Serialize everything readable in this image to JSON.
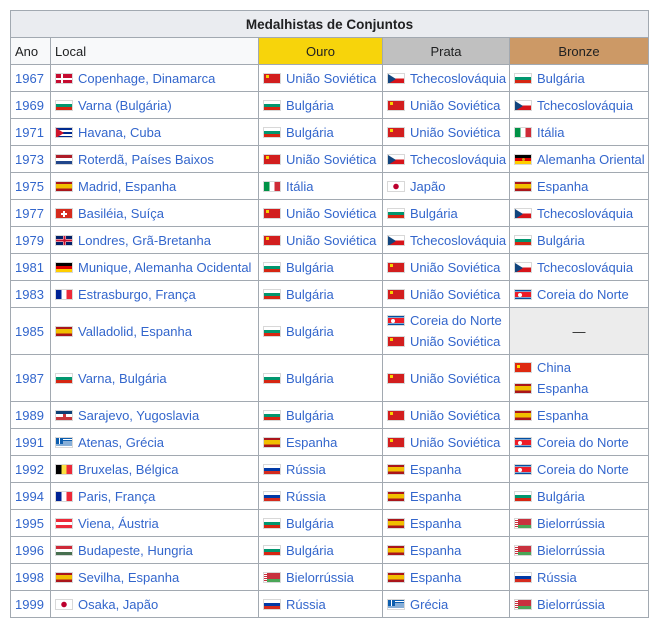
{
  "table": {
    "title": "Medalhistas de Conjuntos",
    "headers": {
      "year": "Ano",
      "local": "Local",
      "gold": "Ouro",
      "silver": "Prata",
      "bronze": "Bronze"
    },
    "colors": {
      "gold": "#f7d40b",
      "silver": "#c0c0c0",
      "bronze": "#cc9966",
      "link": "#3366cc"
    },
    "rows": [
      {
        "year": "1967",
        "local": {
          "flag": "DK",
          "text": "Copenhage, Dinamarca"
        },
        "gold": [
          {
            "flag": "SU",
            "text": "União Soviética"
          }
        ],
        "silver": [
          {
            "flag": "CS",
            "text": "Tchecoslováquia"
          }
        ],
        "bronze": [
          {
            "flag": "BG",
            "text": "Bulgária"
          }
        ]
      },
      {
        "year": "1969",
        "local": {
          "flag": "BG",
          "text": "Varna (Bulgária)"
        },
        "gold": [
          {
            "flag": "BG",
            "text": "Bulgária"
          }
        ],
        "silver": [
          {
            "flag": "SU",
            "text": "União Soviética"
          }
        ],
        "bronze": [
          {
            "flag": "CS",
            "text": "Tchecoslováquia"
          }
        ]
      },
      {
        "year": "1971",
        "local": {
          "flag": "CU",
          "text": "Havana, Cuba"
        },
        "gold": [
          {
            "flag": "BG",
            "text": "Bulgária"
          }
        ],
        "silver": [
          {
            "flag": "SU",
            "text": "União Soviética"
          }
        ],
        "bronze": [
          {
            "flag": "IT",
            "text": "Itália"
          }
        ]
      },
      {
        "year": "1973",
        "local": {
          "flag": "NL",
          "text": "Roterdã, Países Baixos"
        },
        "gold": [
          {
            "flag": "SU",
            "text": "União Soviética"
          }
        ],
        "silver": [
          {
            "flag": "CS",
            "text": "Tchecoslováquia"
          }
        ],
        "bronze": [
          {
            "flag": "DD",
            "text": "Alemanha Oriental"
          }
        ]
      },
      {
        "year": "1975",
        "local": {
          "flag": "ES",
          "text": "Madrid, Espanha"
        },
        "gold": [
          {
            "flag": "IT",
            "text": "Itália"
          }
        ],
        "silver": [
          {
            "flag": "JP",
            "text": "Japão"
          }
        ],
        "bronze": [
          {
            "flag": "ES",
            "text": "Espanha"
          }
        ]
      },
      {
        "year": "1977",
        "local": {
          "flag": "CH",
          "text": "Basiléia, Suíça"
        },
        "gold": [
          {
            "flag": "SU",
            "text": "União Soviética"
          }
        ],
        "silver": [
          {
            "flag": "BG",
            "text": "Bulgária"
          }
        ],
        "bronze": [
          {
            "flag": "CS",
            "text": "Tchecoslováquia"
          }
        ]
      },
      {
        "year": "1979",
        "local": {
          "flag": "GB",
          "text": "Londres, Grã-Bretanha"
        },
        "gold": [
          {
            "flag": "SU",
            "text": "União Soviética"
          }
        ],
        "silver": [
          {
            "flag": "CS",
            "text": "Tchecoslováquia"
          }
        ],
        "bronze": [
          {
            "flag": "BG",
            "text": "Bulgária"
          }
        ]
      },
      {
        "year": "1981",
        "local": {
          "flag": "DE",
          "text": "Munique, Alemanha Ocidental"
        },
        "gold": [
          {
            "flag": "BG",
            "text": "Bulgária"
          }
        ],
        "silver": [
          {
            "flag": "SU",
            "text": "União Soviética"
          }
        ],
        "bronze": [
          {
            "flag": "CS",
            "text": "Tchecoslováquia"
          }
        ]
      },
      {
        "year": "1983",
        "local": {
          "flag": "FR",
          "text": "Estrasburgo, França"
        },
        "gold": [
          {
            "flag": "BG",
            "text": "Bulgária"
          }
        ],
        "silver": [
          {
            "flag": "SU",
            "text": "União Soviética"
          }
        ],
        "bronze": [
          {
            "flag": "KP",
            "text": "Coreia do Norte"
          }
        ]
      },
      {
        "year": "1985",
        "local": {
          "flag": "ES",
          "text": "Valladolid, Espanha"
        },
        "gold": [
          {
            "flag": "BG",
            "text": "Bulgária"
          }
        ],
        "silver": [
          {
            "flag": "KP",
            "text": "Coreia do Norte"
          },
          {
            "flag": "SU",
            "text": "União Soviética"
          }
        ],
        "bronze": [],
        "bronze_none": "—"
      },
      {
        "year": "1987",
        "local": {
          "flag": "BG",
          "text": "Varna, Bulgária"
        },
        "gold": [
          {
            "flag": "BG",
            "text": "Bulgária"
          }
        ],
        "silver": [
          {
            "flag": "SU",
            "text": "União Soviética"
          }
        ],
        "bronze": [
          {
            "flag": "CN",
            "text": "China"
          },
          {
            "flag": "ES",
            "text": "Espanha"
          }
        ]
      },
      {
        "year": "1989",
        "local": {
          "flag": "YU",
          "text": "Sarajevo, Yugoslavia"
        },
        "gold": [
          {
            "flag": "BG",
            "text": "Bulgária"
          }
        ],
        "silver": [
          {
            "flag": "SU",
            "text": "União Soviética"
          }
        ],
        "bronze": [
          {
            "flag": "ES",
            "text": "Espanha"
          }
        ]
      },
      {
        "year": "1991",
        "local": {
          "flag": "GR",
          "text": "Atenas, Grécia"
        },
        "gold": [
          {
            "flag": "ES",
            "text": "Espanha"
          }
        ],
        "silver": [
          {
            "flag": "SU",
            "text": "União Soviética"
          }
        ],
        "bronze": [
          {
            "flag": "KP",
            "text": "Coreia do Norte"
          }
        ]
      },
      {
        "year": "1992",
        "local": {
          "flag": "BE",
          "text": "Bruxelas, Bélgica"
        },
        "gold": [
          {
            "flag": "RU",
            "text": "Rússia"
          }
        ],
        "silver": [
          {
            "flag": "ES",
            "text": "Espanha"
          }
        ],
        "bronze": [
          {
            "flag": "KP",
            "text": "Coreia do Norte"
          }
        ]
      },
      {
        "year": "1994",
        "local": {
          "flag": "FR",
          "text": "Paris, França"
        },
        "gold": [
          {
            "flag": "RU",
            "text": "Rússia"
          }
        ],
        "silver": [
          {
            "flag": "ES",
            "text": "Espanha"
          }
        ],
        "bronze": [
          {
            "flag": "BG",
            "text": "Bulgária"
          }
        ]
      },
      {
        "year": "1995",
        "local": {
          "flag": "AT",
          "text": "Viena, Áustria"
        },
        "gold": [
          {
            "flag": "BG",
            "text": "Bulgária"
          }
        ],
        "silver": [
          {
            "flag": "ES",
            "text": "Espanha"
          }
        ],
        "bronze": [
          {
            "flag": "BY",
            "text": "Bielorrússia"
          }
        ]
      },
      {
        "year": "1996",
        "local": {
          "flag": "HU",
          "text": "Budapeste, Hungria"
        },
        "gold": [
          {
            "flag": "BG",
            "text": "Bulgária"
          }
        ],
        "silver": [
          {
            "flag": "ES",
            "text": "Espanha"
          }
        ],
        "bronze": [
          {
            "flag": "BY",
            "text": "Bielorrússia"
          }
        ]
      },
      {
        "year": "1998",
        "local": {
          "flag": "ES",
          "text": "Sevilha, Espanha"
        },
        "gold": [
          {
            "flag": "BY",
            "text": "Bielorrússia"
          }
        ],
        "silver": [
          {
            "flag": "ES",
            "text": "Espanha"
          }
        ],
        "bronze": [
          {
            "flag": "RU",
            "text": "Rússia"
          }
        ]
      },
      {
        "year": "1999",
        "local": {
          "flag": "JP",
          "text": "Osaka, Japão"
        },
        "gold": [
          {
            "flag": "RU",
            "text": "Rússia"
          }
        ],
        "silver": [
          {
            "flag": "GR",
            "text": "Grécia"
          }
        ],
        "bronze": [
          {
            "flag": "BY",
            "text": "Bielorrússia"
          }
        ]
      }
    ]
  }
}
